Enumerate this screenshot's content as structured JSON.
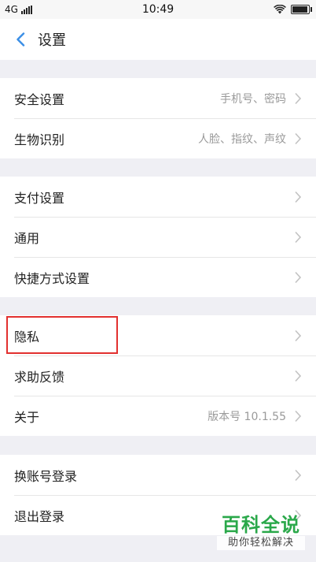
{
  "status_bar": {
    "network": "4G",
    "time": "10:49",
    "battery_level": 0.85
  },
  "nav": {
    "title": "设置",
    "back_icon": "chevron-left-icon"
  },
  "groups": [
    [
      {
        "label": "安全设置",
        "value": "手机号、密码"
      },
      {
        "label": "生物识别",
        "value": "人脸、指纹、声纹"
      }
    ],
    [
      {
        "label": "支付设置",
        "value": ""
      },
      {
        "label": "通用",
        "value": ""
      },
      {
        "label": "快捷方式设置",
        "value": ""
      }
    ],
    [
      {
        "label": "隐私",
        "value": ""
      },
      {
        "label": "求助反馈",
        "value": ""
      },
      {
        "label": "关于",
        "value": "版本号 10.1.55"
      }
    ],
    [
      {
        "label": "换账号登录",
        "value": ""
      },
      {
        "label": "退出登录",
        "value": ""
      }
    ]
  ],
  "highlight_color": "#e2302f",
  "watermark": {
    "main": "百科全说",
    "sub": "助你轻松解决",
    "color": "#2aa84a"
  }
}
